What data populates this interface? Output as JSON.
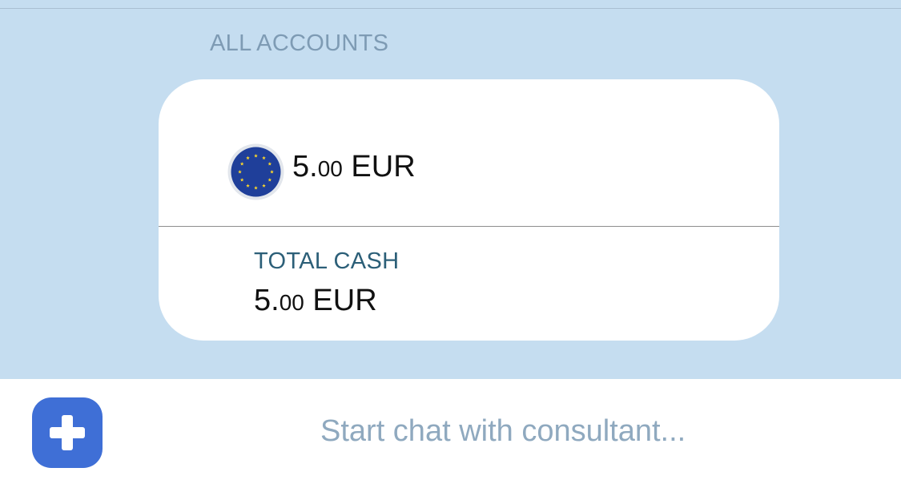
{
  "section": {
    "title": "ALL ACCOUNTS"
  },
  "account": {
    "flag_icon": "eu-flag-icon",
    "amount_int": "5.",
    "amount_dec": "00",
    "currency": "EUR"
  },
  "total": {
    "label": "TOTAL CASH",
    "amount_int": "5.",
    "amount_dec": "00",
    "currency": "EUR"
  },
  "bottom_bar": {
    "add_icon": "plus-icon",
    "chat_placeholder": "Start chat with consultant..."
  },
  "colors": {
    "background": "#c5ddf0",
    "accent": "#3f6fd6",
    "header_text": "#7e9bb4",
    "total_label": "#2c5f78",
    "eu_blue": "#1f3f9a",
    "eu_star": "#f7d42c"
  }
}
